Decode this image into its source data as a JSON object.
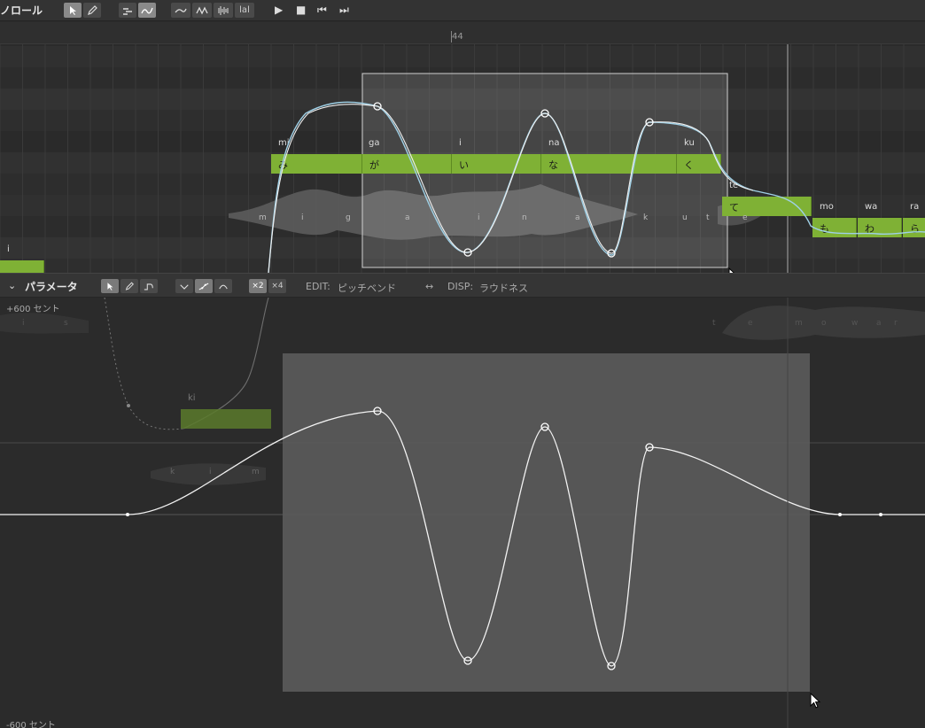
{
  "toolbar": {
    "title": "ノロール",
    "format_label": "lal"
  },
  "ruler": {
    "measure": "44"
  },
  "notes": [
    {
      "phoneme": "mi",
      "lyric": "み"
    },
    {
      "phoneme": "ga",
      "lyric": "が"
    },
    {
      "phoneme": "i",
      "lyric": "い"
    },
    {
      "phoneme": "na",
      "lyric": "な"
    },
    {
      "phoneme": "ku",
      "lyric": "く"
    },
    {
      "phoneme": "te",
      "lyric": "て"
    },
    {
      "phoneme": "mo",
      "lyric": "も"
    },
    {
      "phoneme": "wa",
      "lyric": "わ"
    },
    {
      "phoneme": "ra",
      "lyric": "ら"
    },
    {
      "phoneme": "i",
      "lyric": ""
    }
  ],
  "waveform_phonemes": [
    "m",
    "i",
    "g",
    "a",
    "i",
    "n",
    "a",
    "k",
    "u",
    "t",
    "e"
  ],
  "param_header": {
    "title": "パラメータ",
    "mult2": "×2",
    "mult4": "×4",
    "edit_label": "EDIT:",
    "edit_value": "ピッチベンド",
    "disp_arrow": "↔",
    "disp_label": "DISP:",
    "disp_value": "ラウドネス"
  },
  "param_area": {
    "top_label": "+600 セント",
    "bottom_label": "-600 セント",
    "ghost_phoneme": "ki",
    "ghost_wave_labels": [
      "k",
      "i",
      "m"
    ],
    "ghost_top_labels": [
      "i",
      "s",
      "t",
      "e",
      "m",
      "o",
      "w",
      "a",
      "r"
    ]
  },
  "colors": {
    "note_green": "#7fb135",
    "pitch_line": "#9fd0e6",
    "selection": "#5a5a5a"
  }
}
